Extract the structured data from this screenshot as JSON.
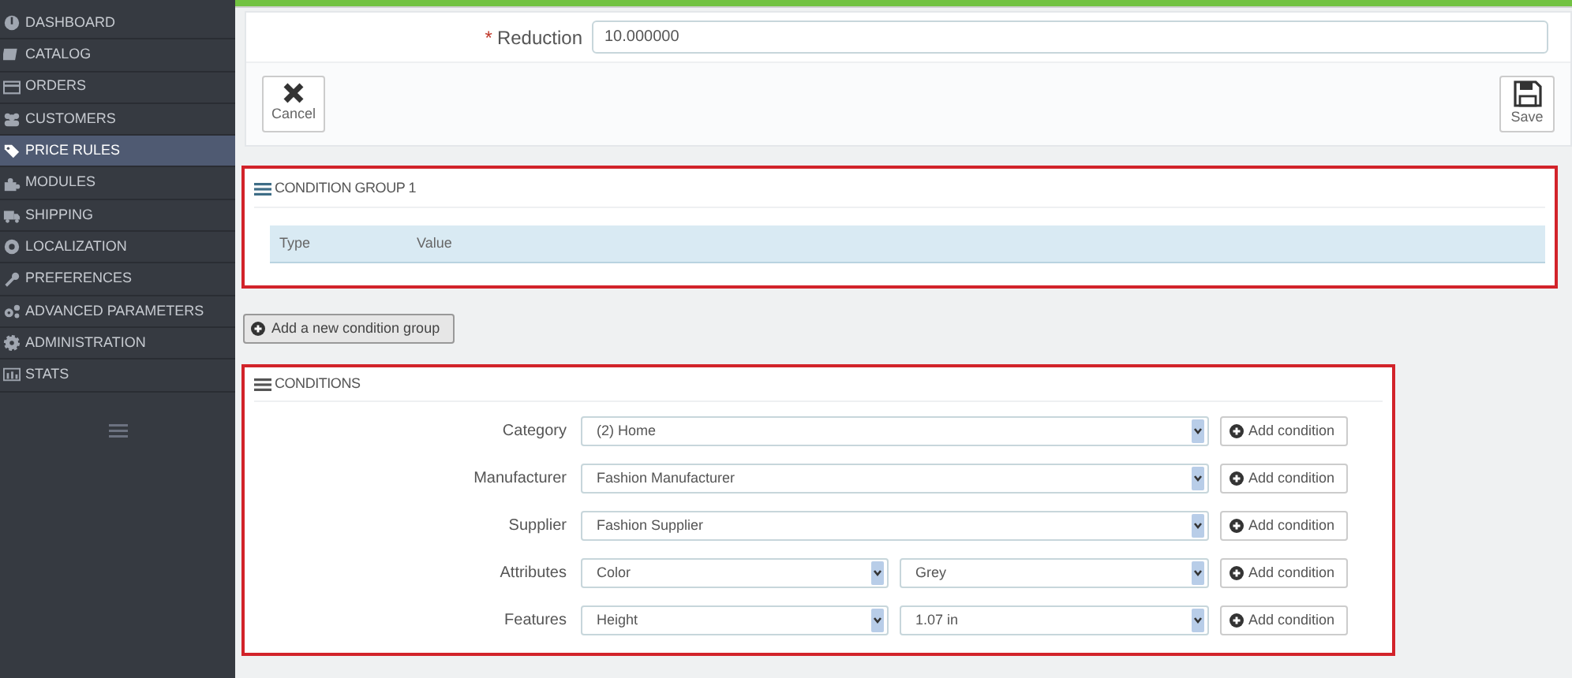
{
  "sidebar": {
    "items": [
      {
        "label": "DASHBOARD",
        "selected": false
      },
      {
        "label": "CATALOG",
        "selected": false
      },
      {
        "label": "ORDERS",
        "selected": false
      },
      {
        "label": "CUSTOMERS",
        "selected": false
      },
      {
        "label": "PRICE RULES",
        "selected": true
      },
      {
        "label": "MODULES",
        "selected": false
      },
      {
        "label": "SHIPPING",
        "selected": false
      },
      {
        "label": "LOCALIZATION",
        "selected": false
      },
      {
        "label": "PREFERENCES",
        "selected": false
      },
      {
        "label": "ADVANCED PARAMETERS",
        "selected": false
      },
      {
        "label": "ADMINISTRATION",
        "selected": false
      },
      {
        "label": "STATS",
        "selected": false
      }
    ]
  },
  "reduction": {
    "required_mark": "*",
    "label": "Reduction",
    "value": "10.000000"
  },
  "actions": {
    "cancel": "Cancel",
    "save": "Save"
  },
  "condition_group": {
    "title": "CONDITION GROUP 1",
    "columns": [
      "Type",
      "Value"
    ]
  },
  "add_group_button": "Add a new condition group",
  "conditions": {
    "title": "CONDITIONS",
    "rows": [
      {
        "kind": "single",
        "label": "Category",
        "values": [
          "(2) Home"
        ],
        "button": "Add condition"
      },
      {
        "kind": "single",
        "label": "Manufacturer",
        "values": [
          "Fashion Manufacturer"
        ],
        "button": "Add condition"
      },
      {
        "kind": "single",
        "label": "Supplier",
        "values": [
          "Fashion Supplier"
        ],
        "button": "Add condition"
      },
      {
        "kind": "pair",
        "label": "Attributes",
        "values": [
          "Color",
          "Grey"
        ],
        "button": "Add condition"
      },
      {
        "kind": "pair",
        "label": "Features",
        "values": [
          "Height",
          "1.07 in"
        ],
        "button": "Add condition"
      }
    ]
  }
}
